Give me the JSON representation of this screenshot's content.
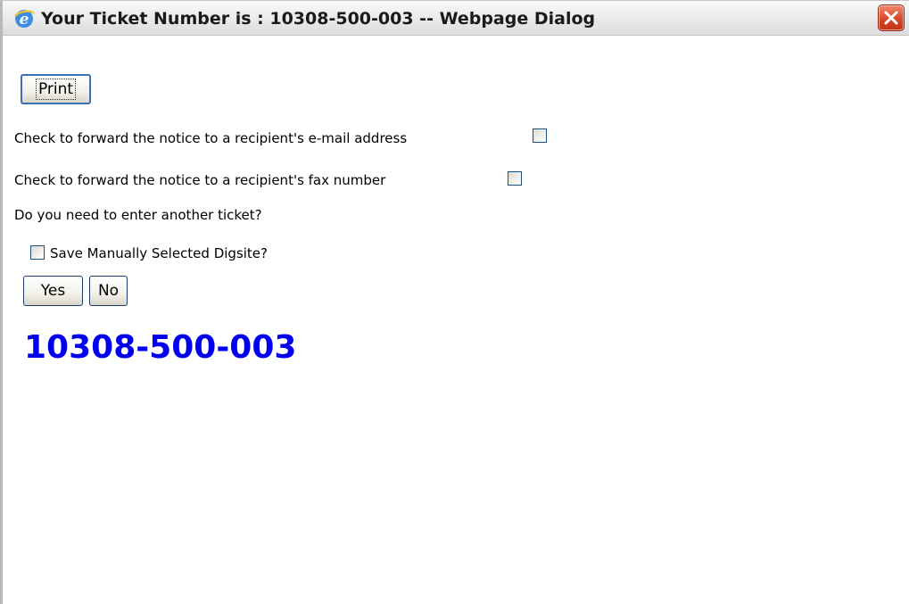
{
  "window": {
    "title": "Your Ticket Number is : 10308-500-003 -- Webpage Dialog",
    "close_icon": "close-icon",
    "app_icon": "internet-explorer-icon"
  },
  "actions": {
    "print_label": "Print",
    "yes_label": "Yes",
    "no_label": "No"
  },
  "options": {
    "forward_email_label": "Check to forward the notice to a recipient's e-mail address",
    "forward_email_checked": false,
    "forward_fax_label": "Check to forward the notice to a recipient's fax number",
    "forward_fax_checked": false,
    "save_digsite_label": "Save Manually Selected Digsite?",
    "save_digsite_checked": false
  },
  "prompt": {
    "another_ticket": "Do you need to enter another ticket?"
  },
  "ticket": {
    "number": "10308-500-003",
    "color": "#0000ee"
  }
}
